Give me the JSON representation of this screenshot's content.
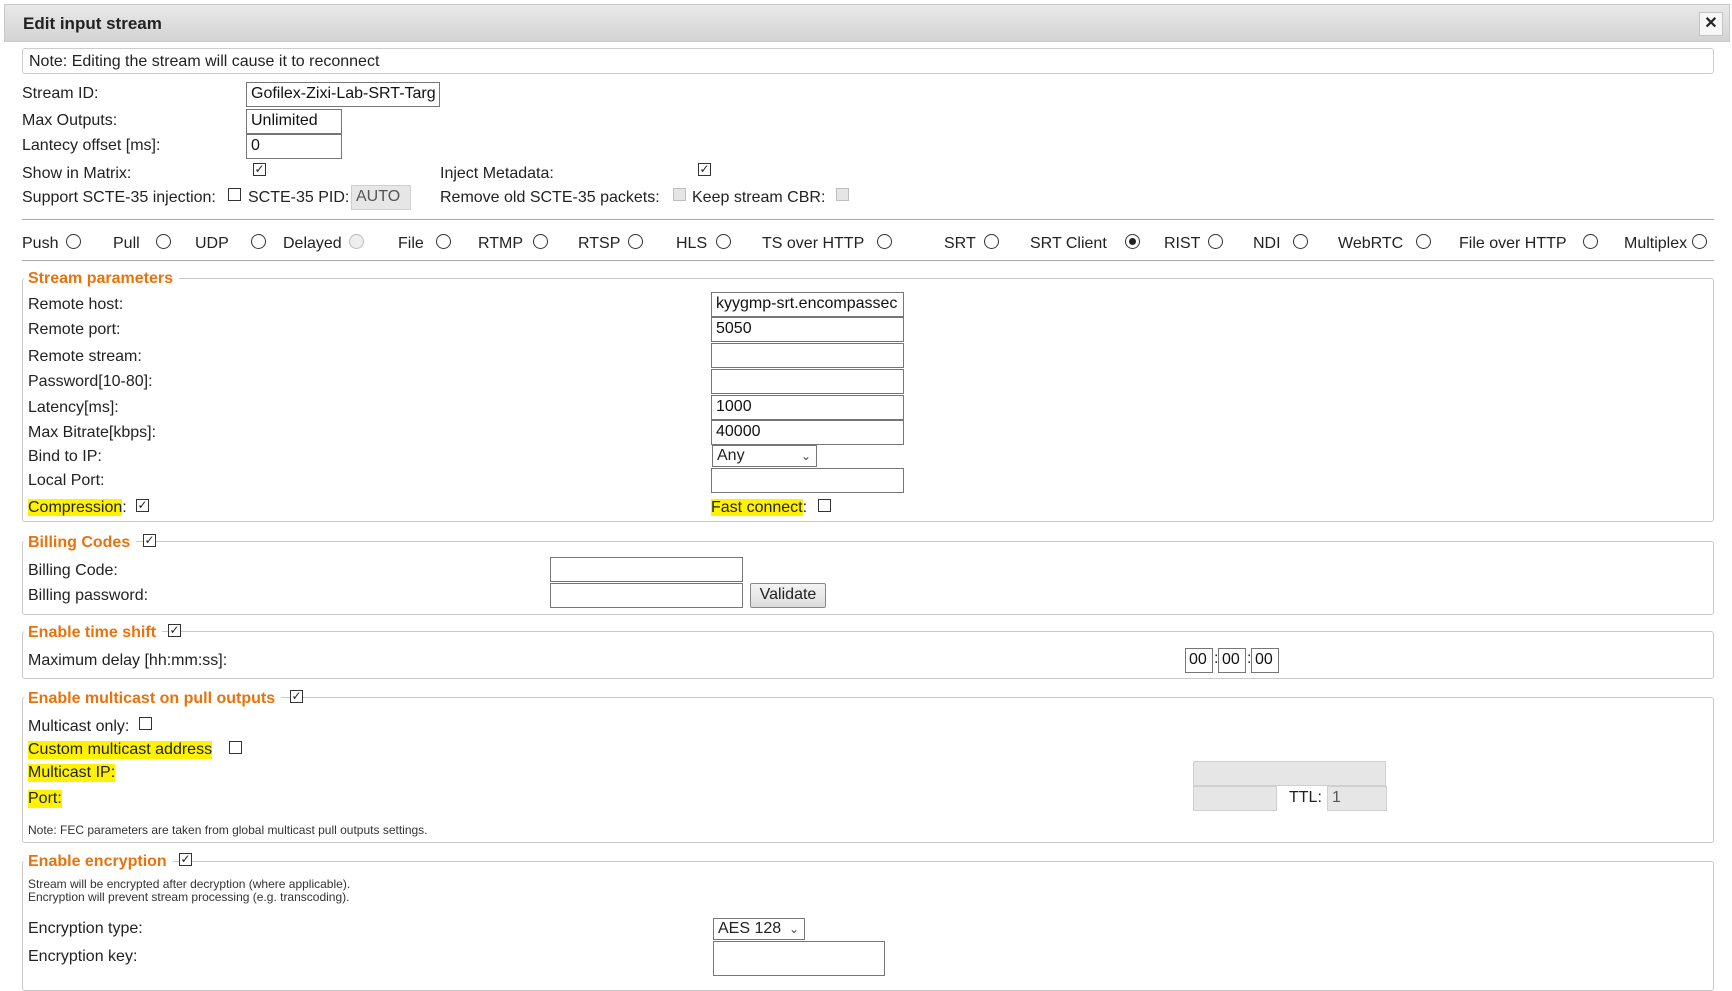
{
  "dialog": {
    "title": "Edit input stream",
    "close": "✕",
    "note": "Note: Editing the stream will cause it to reconnect"
  },
  "general": {
    "stream_id_label": "Stream ID:",
    "stream_id_value": "Gofilex-Zixi-Lab-SRT-Targ",
    "max_outputs_label": "Max Outputs:",
    "max_outputs_value": "Unlimited",
    "latency_offset_label": "Lantecy offset [ms]:",
    "latency_offset_value": "0",
    "show_in_matrix_label": "Show in Matrix:",
    "inject_metadata_label": "Inject Metadata:",
    "scte35_label": "Support SCTE-35 injection:",
    "scte35_pid_label": "SCTE-35 PID:",
    "scte35_pid_value": "AUTO",
    "remove_scte35_label": "Remove old SCTE-35 packets:",
    "keep_cbr_label": "Keep stream CBR:"
  },
  "protocols": [
    {
      "label": "Push",
      "checked": false,
      "disabled": false
    },
    {
      "label": "Pull",
      "checked": false,
      "disabled": false
    },
    {
      "label": "UDP",
      "checked": false,
      "disabled": false
    },
    {
      "label": "Delayed",
      "checked": false,
      "disabled": true
    },
    {
      "label": "File",
      "checked": false,
      "disabled": false
    },
    {
      "label": "RTMP",
      "checked": false,
      "disabled": false
    },
    {
      "label": "RTSP",
      "checked": false,
      "disabled": false
    },
    {
      "label": "HLS",
      "checked": false,
      "disabled": false
    },
    {
      "label": "TS over HTTP",
      "checked": false,
      "disabled": false
    },
    {
      "label": "SRT",
      "checked": false,
      "disabled": false
    },
    {
      "label": "SRT Client",
      "checked": true,
      "disabled": false
    },
    {
      "label": "RIST",
      "checked": false,
      "disabled": false
    },
    {
      "label": "NDI",
      "checked": false,
      "disabled": false
    },
    {
      "label": "WebRTC",
      "checked": false,
      "disabled": false
    },
    {
      "label": "File over HTTP",
      "checked": false,
      "disabled": false
    },
    {
      "label": "Multiplex",
      "checked": false,
      "disabled": false
    }
  ],
  "stream_params": {
    "legend": "Stream parameters",
    "remote_host_label": "Remote host:",
    "remote_host_value": "kyygmp-srt.encompassec",
    "remote_port_label": "Remote port:",
    "remote_port_value": "5050",
    "remote_stream_label": "Remote stream:",
    "remote_stream_value": "",
    "password_label": "Password[10-80]:",
    "password_value": "",
    "latency_label": "Latency[ms]:",
    "latency_value": "1000",
    "max_bitrate_label": "Max Bitrate[kbps]:",
    "max_bitrate_value": "40000",
    "bind_ip_label": "Bind to IP:",
    "bind_ip_value": "Any",
    "local_port_label": "Local Port:",
    "local_port_value": "",
    "compression_label": "Compression",
    "fast_connect_label": "Fast connect"
  },
  "billing": {
    "legend": "Billing Codes",
    "code_label": "Billing Code:",
    "password_label": "Billing password:",
    "validate_label": "Validate"
  },
  "timeshift": {
    "legend": "Enable time shift",
    "max_delay_label": "Maximum delay [hh:mm:ss]:",
    "hh": "00",
    "mm": "00",
    "ss": "00"
  },
  "multicast": {
    "legend": "Enable multicast on pull outputs",
    "only_label": "Multicast only:",
    "custom_label": "Custom multicast address",
    "ip_label": "Multicast IP:",
    "port_label": "Port:",
    "ttl_label": "TTL:",
    "ttl_value": "1",
    "note": "Note: FEC parameters are taken from global multicast pull outputs settings."
  },
  "encryption": {
    "legend": "Enable encryption",
    "note1": "Stream will be encrypted after decryption (where applicable).",
    "note2": "Encryption will prevent stream processing (e.g. transcoding).",
    "type_label": "Encryption type:",
    "type_value": "AES 128",
    "key_label": "Encryption key:"
  },
  "colors": {
    "legend": "#e8720c",
    "highlight": "#fff200"
  }
}
